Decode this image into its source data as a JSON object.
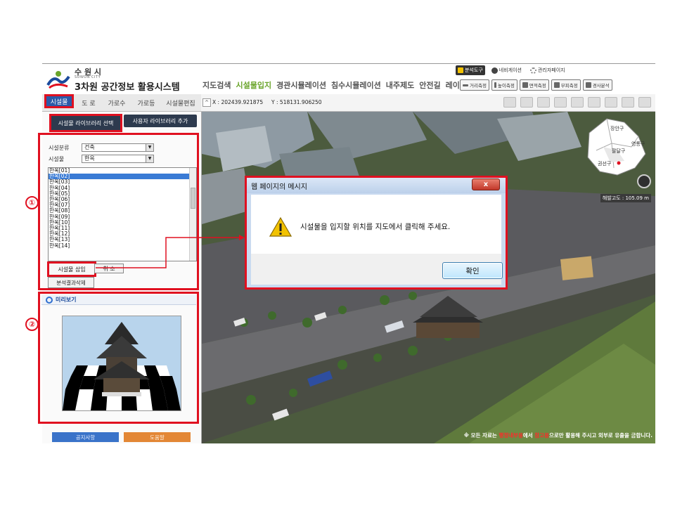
{
  "header": {
    "city_name": "수 원 시",
    "city_sub": "SUWON CITY",
    "system_name": "3차원 공간정보 활용시스템",
    "menu": [
      "지도검색",
      "시설물입지",
      "경관시뮬레이션",
      "침수시뮬레이션",
      "내주제도",
      "안전길",
      "레이어"
    ],
    "menu_active_index": 1,
    "top_tools": [
      "분석도구",
      "네비게이션",
      "관리자페이지"
    ],
    "measure_tools": [
      "거리측정",
      "높이측정",
      "면적측정",
      "부피측정",
      "경사분석"
    ]
  },
  "tabs": {
    "items": [
      "시설물",
      "도  로",
      "가로수",
      "가로등",
      "시설물편집"
    ],
    "active_index": 0
  },
  "coords": {
    "toggle": "^",
    "x_label": "X :",
    "x_value": "202439.921875",
    "y_label": "Y :",
    "y_value": "518131.906250"
  },
  "left_panel": {
    "lib_select_label": "시설물 라이브러리 선택",
    "lib_add_label": "사용자 라이브러리 추가",
    "category_label": "시설분류",
    "category_value": "건축",
    "facility_label": "시설물",
    "facility_value": "한옥",
    "list_items": [
      "한옥[01]",
      "한옥[02]",
      "한옥[03]",
      "한옥[04]",
      "한옥[05]",
      "한옥[06]",
      "한옥[07]",
      "한옥[08]",
      "한옥[09]",
      "한옥[10]",
      "한옥[11]",
      "한옥[12]",
      "한옥[13]",
      "한옥[14]"
    ],
    "list_selected_index": 1,
    "insert_label": "시설물 삽입",
    "cancel_label": "취 소",
    "clear_label": "분석결과삭제",
    "preview_title": "미리보기",
    "notice_label": "공지사항",
    "help_label": "도움말"
  },
  "map": {
    "minimap_districts": [
      "장안구",
      "영통구",
      "팔달구",
      "권선구"
    ],
    "altitude": "해발고도 : 105.09 m",
    "footer_pre": "※ 모든 자료는 ",
    "footer_red1": "행정내부용",
    "footer_mid": "에서 ",
    "footer_red2": "참고용",
    "footer_post": "으로만 활용해 주시고 외부로 유출을 금합니다."
  },
  "dialog": {
    "title": "웹 페이지의 메시지",
    "close_symbol": "x",
    "message": "시설물을 입지할 위치를 지도에서 클릭해 주세요.",
    "ok_label": "확인"
  },
  "callouts": [
    "①",
    "②"
  ],
  "colors": {
    "highlight_red": "#e01020",
    "active_tab_blue": "#2c5aa8",
    "menu_active_green": "#6aa52b",
    "notice_blue": "#3a73c9",
    "help_orange": "#e38736"
  }
}
